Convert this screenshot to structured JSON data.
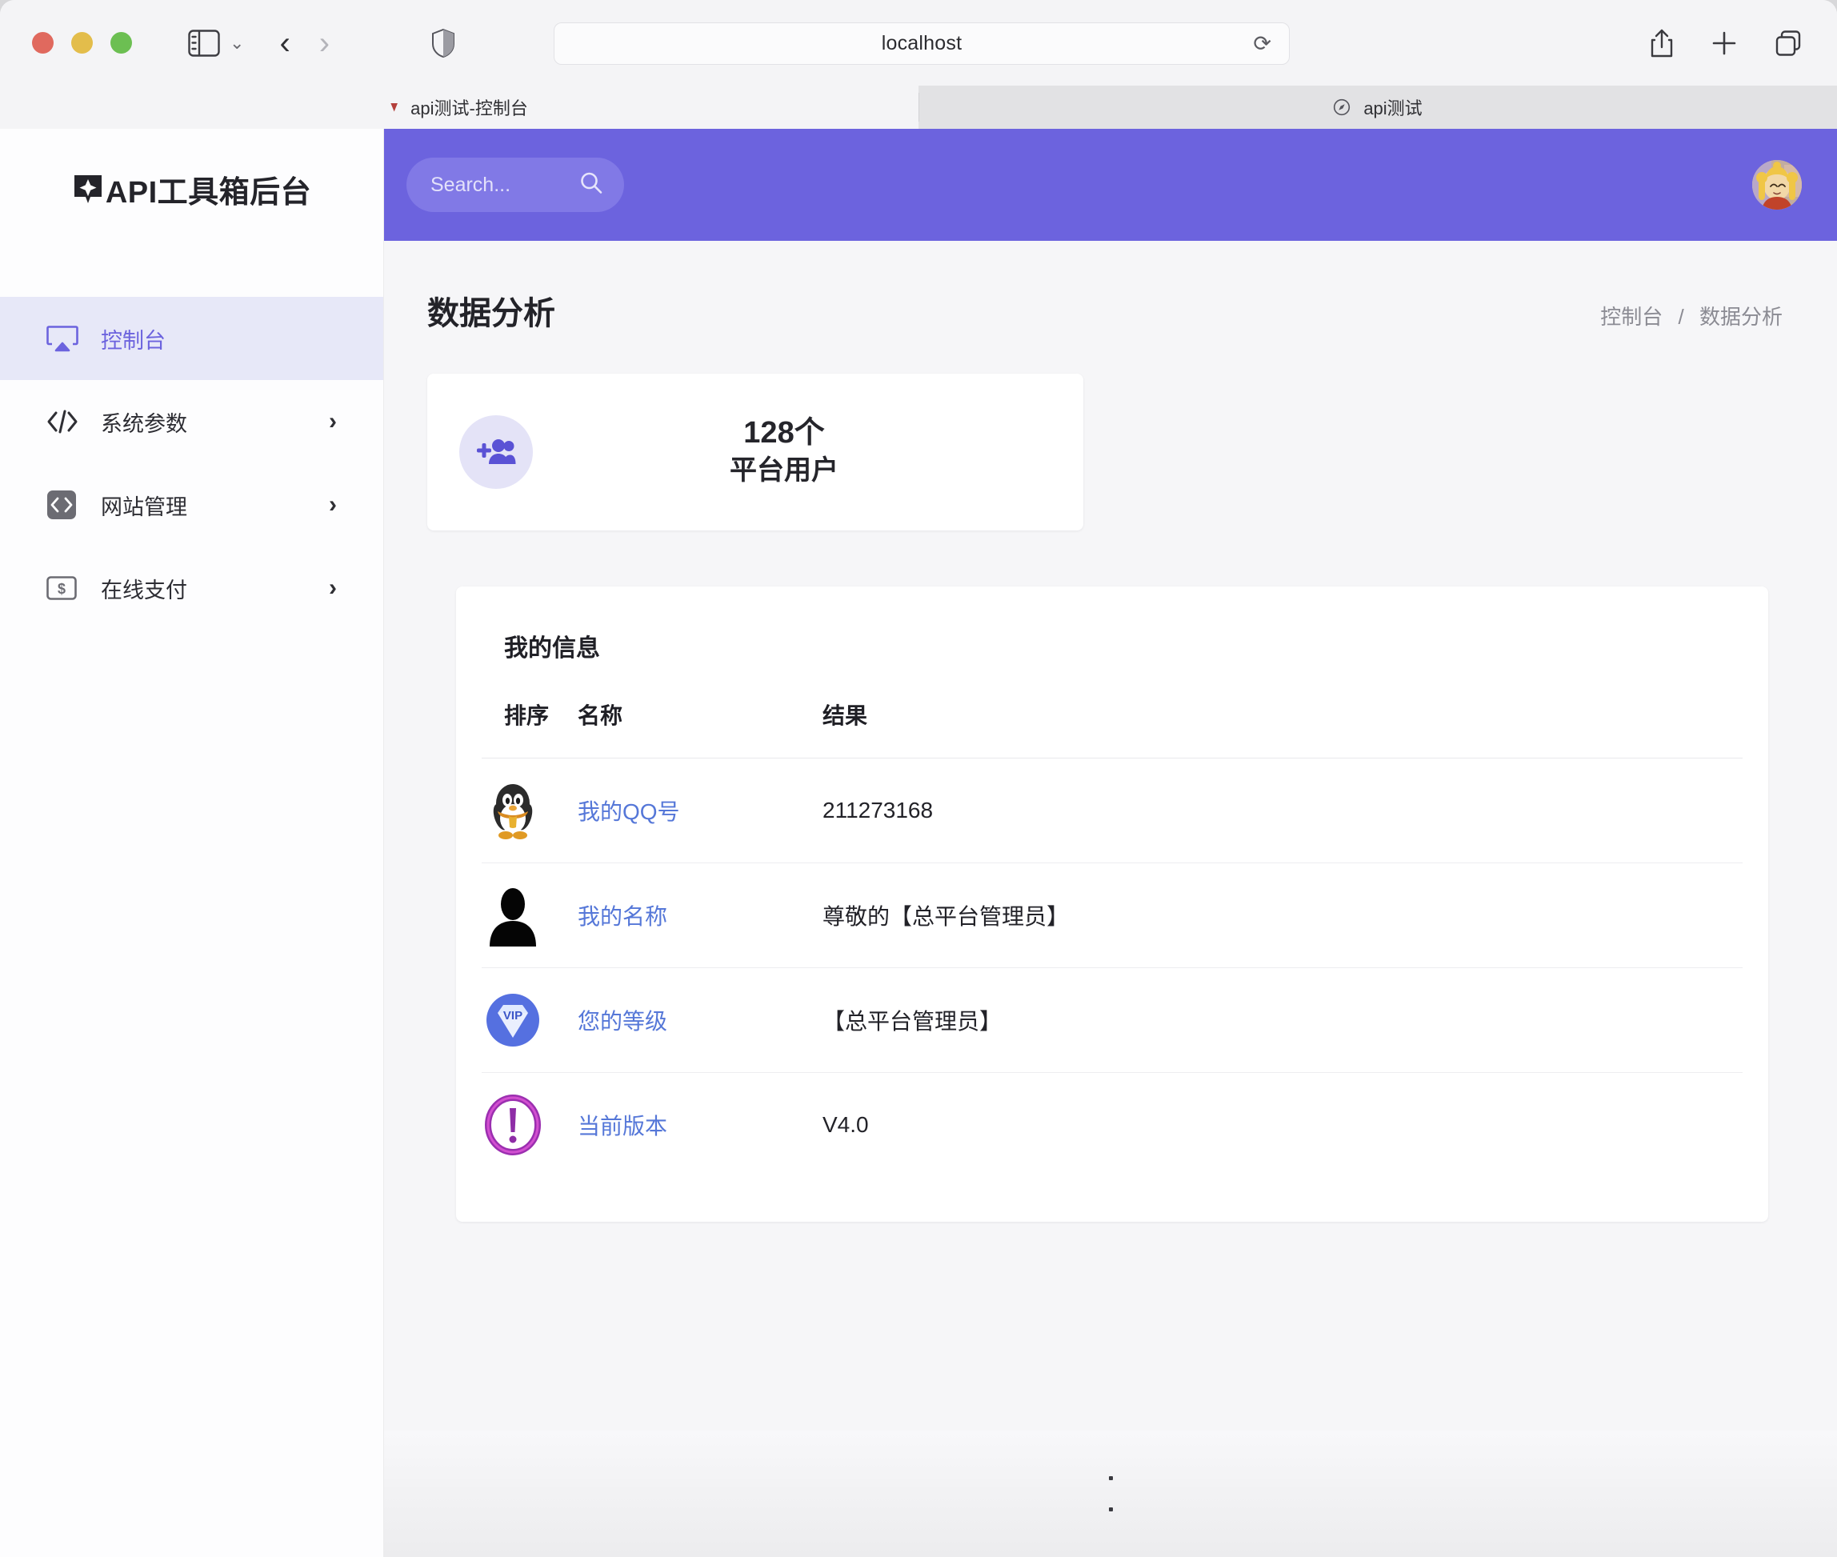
{
  "browser": {
    "url": "localhost",
    "tabs": [
      {
        "title": "api测试-控制台",
        "active": true
      },
      {
        "title": "api测试",
        "active": false
      }
    ],
    "icons": {
      "sidebar_toggle": "sidebar-toggle-icon",
      "tab_overview_chevron": "chevron-down-icon",
      "back": "‹",
      "forward": "›",
      "shield": "shield-icon",
      "reload": "⟳",
      "share": "share-icon",
      "new_tab": "plus-icon",
      "tab_overview": "tab-overview-icon"
    }
  },
  "sidebar": {
    "brand": "API工具箱后台",
    "brand_icon": "sparkle-badge-icon",
    "items": [
      {
        "label": "控制台",
        "icon": "monitor-airplay-icon",
        "active": true,
        "has_chevron": false
      },
      {
        "label": "系统参数",
        "icon": "code-slash-icon",
        "active": false,
        "has_chevron": true
      },
      {
        "label": "网站管理",
        "icon": "code-square-icon",
        "active": false,
        "has_chevron": true
      },
      {
        "label": "在线支付",
        "icon": "dollar-card-icon",
        "active": false,
        "has_chevron": true
      }
    ],
    "chevron": "›"
  },
  "topbar": {
    "search_placeholder": "Search...",
    "search_icon": "search-icon",
    "avatar": "user-avatar"
  },
  "page": {
    "title": "数据分析",
    "breadcrumb": {
      "parent": "控制台",
      "separator": "/",
      "current": "数据分析"
    }
  },
  "stat_card": {
    "icon": "add-users-icon",
    "value": "128个",
    "label": "平台用户"
  },
  "info_card": {
    "title": "我的信息",
    "columns": [
      "排序",
      "名称",
      "结果"
    ],
    "rows": [
      {
        "icon": "qq-penguin-icon",
        "name": "我的QQ号",
        "result": "211273168"
      },
      {
        "icon": "person-silhouette-icon",
        "name": "我的名称",
        "result": "尊敬的【总平台管理员】"
      },
      {
        "icon": "vip-diamond-icon",
        "name": "您的等级",
        "result": "【总平台管理员】"
      },
      {
        "icon": "exclamation-circle-icon",
        "name": "当前版本",
        "result": "V4.0"
      }
    ]
  },
  "footer": {
    "dot1": "",
    "dot2": ""
  },
  "colors": {
    "accent_purple": "#6c63de",
    "search_field": "#8179e6",
    "sidebar_active_bg": "#e7e8f8",
    "link_blue": "#5577d8",
    "page_bg": "#f6f6f8"
  }
}
